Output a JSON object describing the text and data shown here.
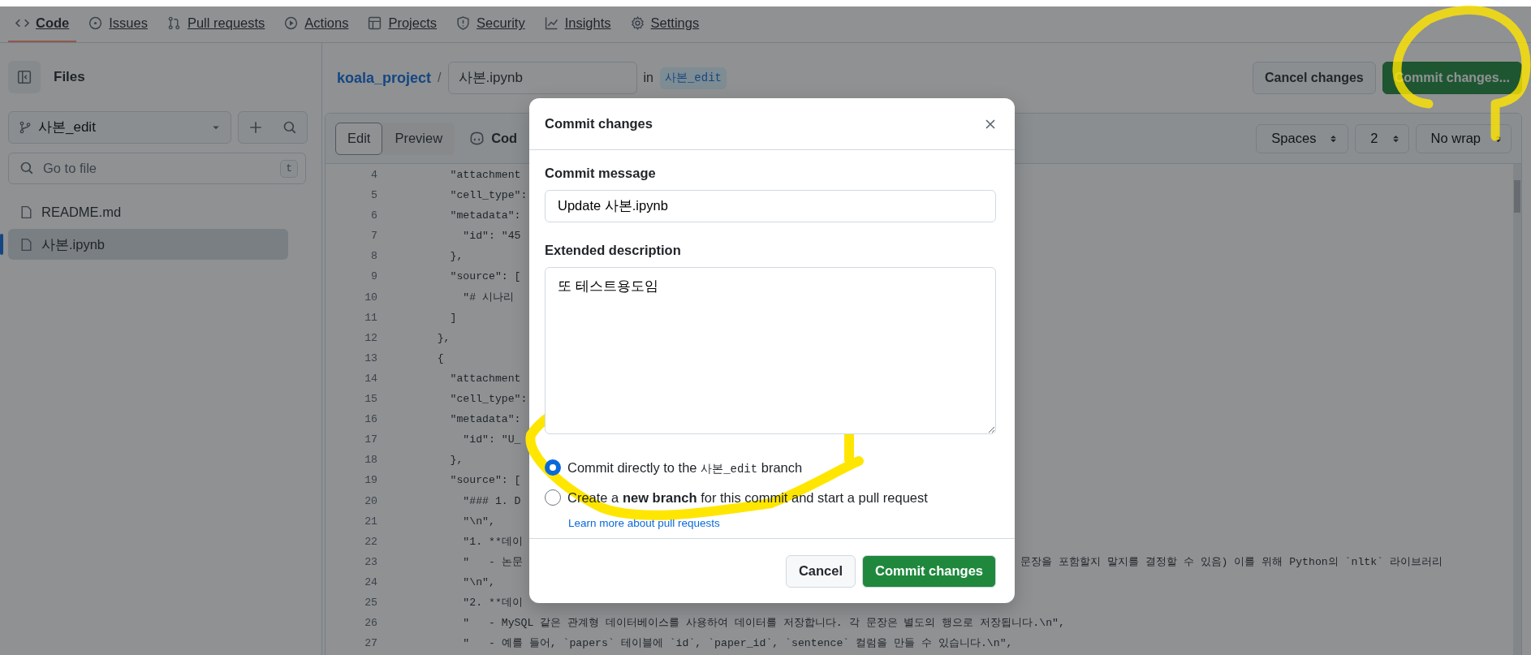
{
  "nav_tabs": [
    {
      "label": "Code",
      "selected": true
    },
    {
      "label": "Issues",
      "selected": false
    },
    {
      "label": "Pull requests",
      "selected": false
    },
    {
      "label": "Actions",
      "selected": false
    },
    {
      "label": "Projects",
      "selected": false
    },
    {
      "label": "Security",
      "selected": false
    },
    {
      "label": "Insights",
      "selected": false
    },
    {
      "label": "Settings",
      "selected": false
    }
  ],
  "sidebar": {
    "title": "Files",
    "branch": "사본_edit",
    "search": {
      "placeholder": "Go to file",
      "shortcut": "t"
    },
    "files": [
      {
        "name": "README.md",
        "selected": false
      },
      {
        "name": "사본.ipynb",
        "selected": true
      }
    ]
  },
  "breadcrumb": {
    "repo": "koala_project",
    "separator": "/",
    "filename": "사본.ipynb",
    "in": "in",
    "branch": "사본_edit"
  },
  "actions": [
    {
      "label": "Cancel changes",
      "kind": "default"
    },
    {
      "label": "Commit changes...",
      "kind": "primary"
    }
  ],
  "editor": {
    "modes": [
      {
        "label": "Edit",
        "selected": true
      },
      {
        "label": "Preview",
        "selected": false
      }
    ],
    "copilot": "Cod",
    "selects": [
      "Spaces",
      "2",
      "No wrap"
    ],
    "lines": [
      {
        "number": "4",
        "text": "      \"attachment"
      },
      {
        "number": "5",
        "text": "      \"cell_type\":"
      },
      {
        "number": "6",
        "text": "      \"metadata\":"
      },
      {
        "number": "7",
        "text": "        \"id\": \"45"
      },
      {
        "number": "8",
        "text": "      },"
      },
      {
        "number": "9",
        "text": "      \"source\": ["
      },
      {
        "number": "10",
        "text": "        \"# 시나리"
      },
      {
        "number": "11",
        "text": "      ]"
      },
      {
        "number": "12",
        "text": "    },"
      },
      {
        "number": "13",
        "text": "    {"
      },
      {
        "number": "14",
        "text": "      \"attachment"
      },
      {
        "number": "15",
        "text": "      \"cell_type\":"
      },
      {
        "number": "16",
        "text": "      \"metadata\":"
      },
      {
        "number": "17",
        "text": "        \"id\": \"U_"
      },
      {
        "number": "18",
        "text": "      },"
      },
      {
        "number": "19",
        "text": "      \"source\": ["
      },
      {
        "number": "20",
        "text": "        \"### 1. D"
      },
      {
        "number": "21",
        "text": "        \"\\n\","
      },
      {
        "number": "22",
        "text": "        \"1. **데이"
      },
      {
        "number": "23",
        "text": "        \"   - 논문",
        "right": "문장을 포함할지 말지를 결정할 수 있음) 이를 위해 Python의 `nltk` 라이브러리"
      },
      {
        "number": "24",
        "text": "        \"\\n\","
      },
      {
        "number": "25",
        "text": "        \"2. **데이"
      },
      {
        "number": "26",
        "text": "        \"   - MySQL 같은 관계형 데이터베이스를 사용하여 데이터를 저장합니다. 각 문장은 별도의 행으로 저장됩니다.\\n\","
      },
      {
        "number": "27",
        "text": "        \"   - 예를 들어, `papers` 테이블에 `id`, `paper_id`, `sentence` 컬럼을 만들 수 있습니다.\\n\","
      }
    ]
  },
  "dialog": {
    "title": "Commit changes",
    "message_label": "Commit message",
    "message": "Update 사본.ipynb",
    "description_label": "Extended description",
    "description": "또 테스트용도임",
    "options": [
      {
        "kind": "direct",
        "prefix": "Commit directly to the",
        "branch": "사본_edit",
        "suffix": "branch",
        "selected": true
      },
      {
        "kind": "new",
        "text": "Create a **new branch** for this commit and start a pull request",
        "link": "Learn more about pull requests",
        "selected": false
      }
    ],
    "buttons": [
      {
        "label": "Cancel",
        "kind": "default"
      },
      {
        "label": "Commit changes",
        "kind": "primary"
      }
    ]
  }
}
